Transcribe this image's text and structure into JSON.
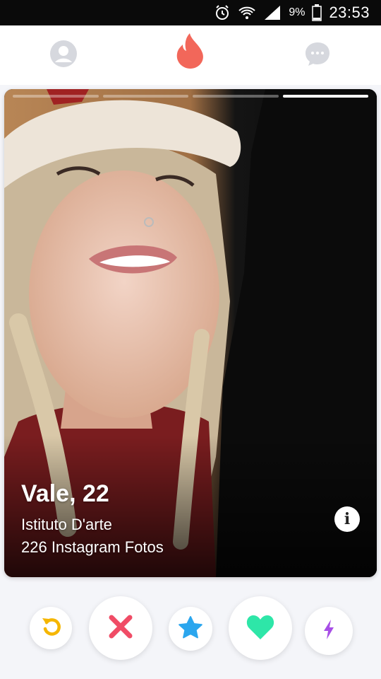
{
  "status_bar": {
    "battery_percent": "9%",
    "time": "23:53",
    "icons": [
      "alarm-icon",
      "wifi-icon",
      "signal-icon",
      "battery-icon"
    ]
  },
  "nav": {
    "icons": [
      "profile-icon",
      "flame-icon",
      "messages-icon"
    ],
    "colors": {
      "flame": "#f2675a",
      "inactive": "#d6d8de"
    }
  },
  "card": {
    "photo_index": 4,
    "photo_count": 4,
    "name_age": "Vale, 22",
    "school": "Istituto D'arte",
    "instagram": "226 Instagram Fotos"
  },
  "actions": {
    "icons": [
      "rewind-icon",
      "nope-icon",
      "super-like-icon",
      "like-icon",
      "boost-icon"
    ],
    "colors": {
      "rewind": "#f5b600",
      "nope": "#f04c66",
      "super_like": "#2ba6ee",
      "like": "#2ee6a8",
      "boost": "#a74ee6"
    }
  }
}
